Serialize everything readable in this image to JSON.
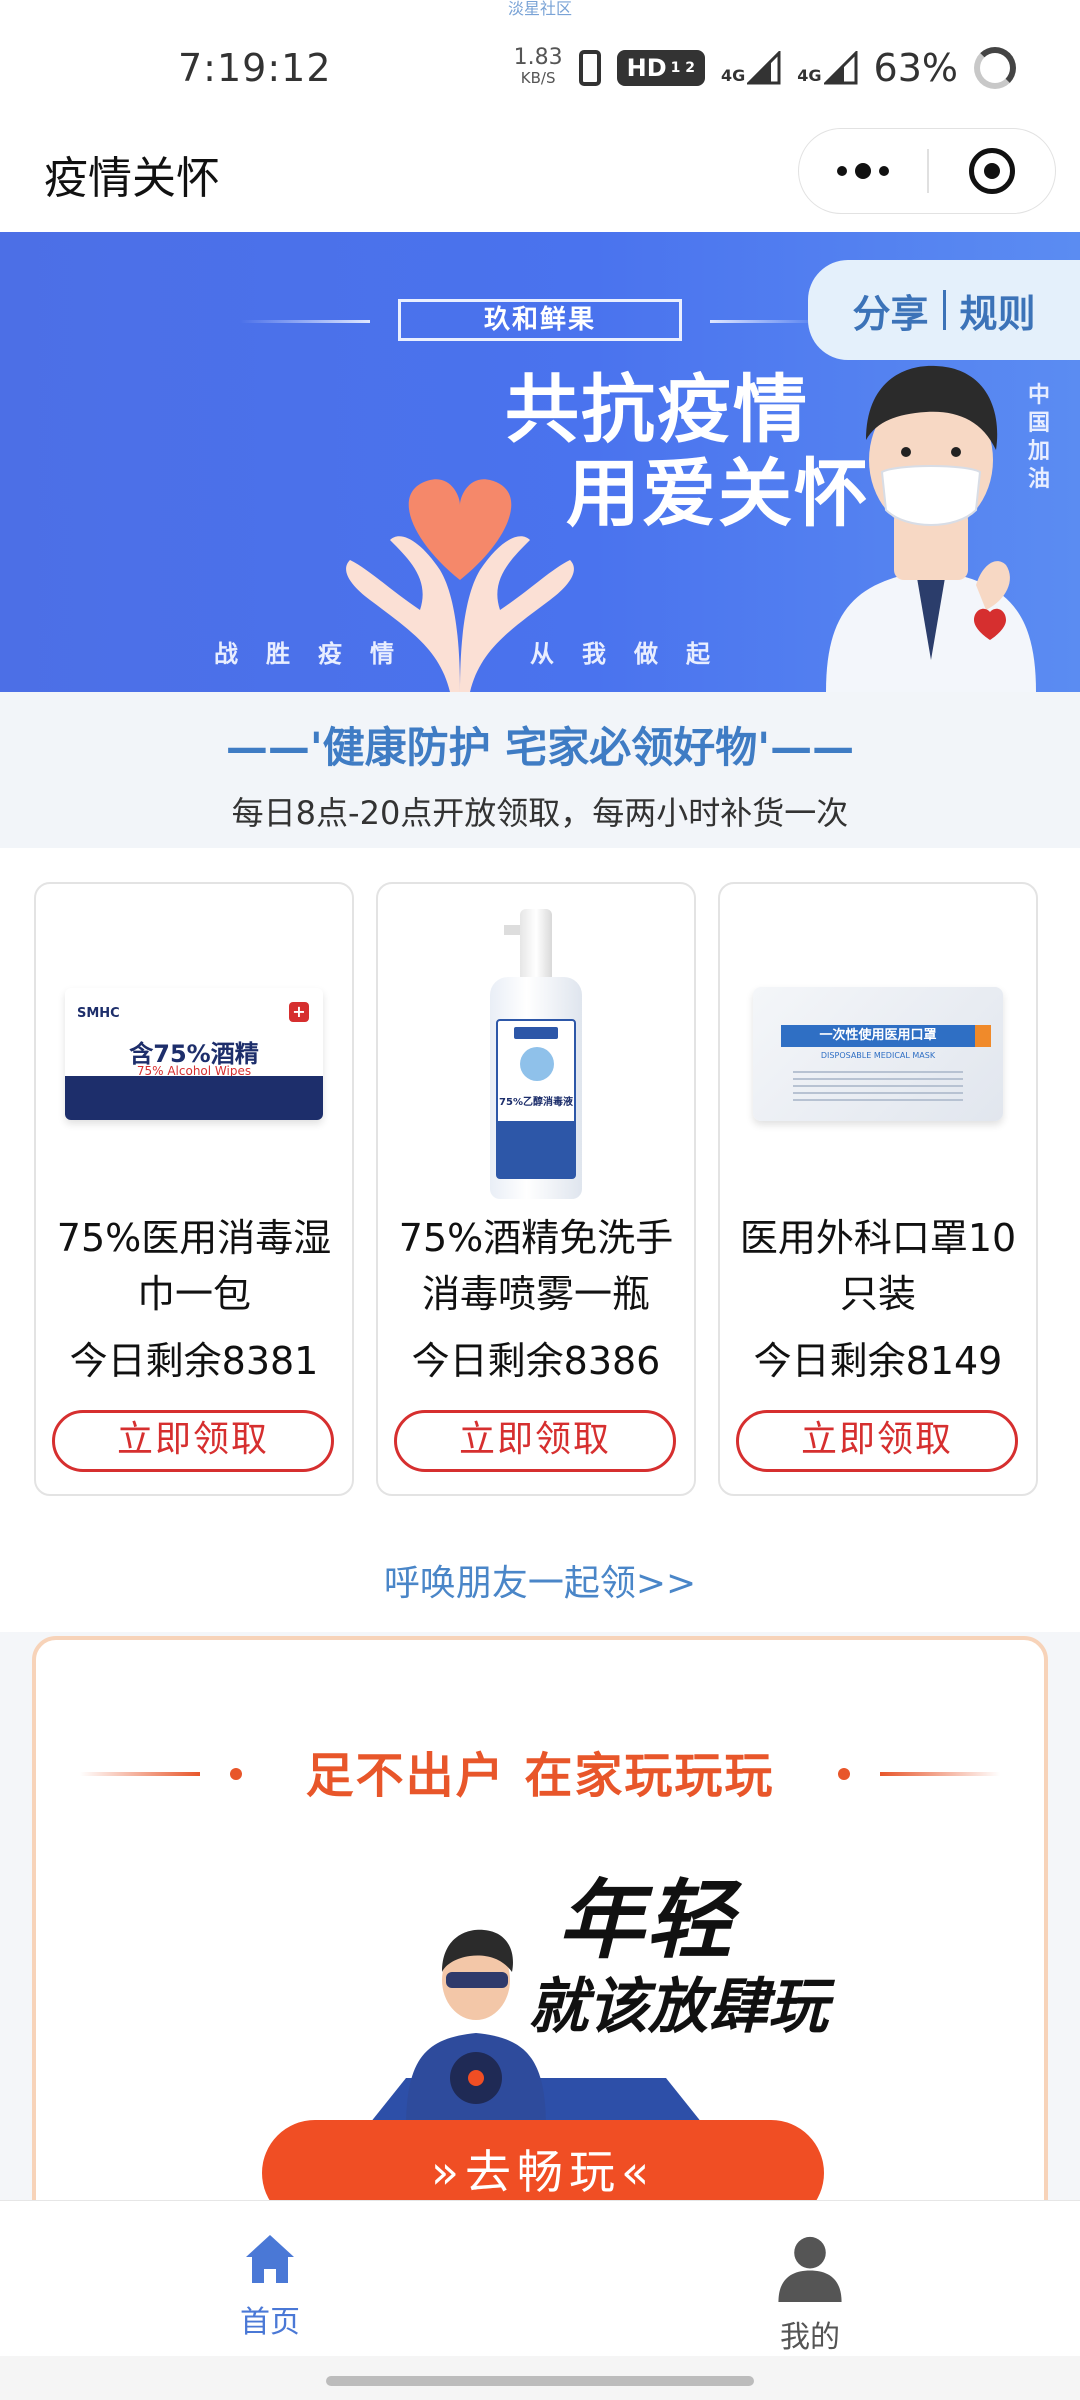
{
  "status": {
    "top_text": "淡星社区",
    "time": "7:19:12",
    "speed_value": "1.83",
    "speed_unit": "KB/S",
    "hd": "HD",
    "hd_sub": "1 2",
    "net1": "4G",
    "net2": "4G",
    "battery": "63%"
  },
  "navbar": {
    "title": "疫情关怀"
  },
  "banner": {
    "brand": "玖和鲜果",
    "headline1": "共抗疫情",
    "headline2": "用爱关怀",
    "slogan_left": "战胜疫情",
    "slogan_right": "从我做起",
    "vertical": "中国加油",
    "share_label": "分享",
    "rules_label": "规则"
  },
  "section": {
    "title": "——'健康防护 宅家必领好物'——",
    "subtitle": "每日8点-20点开放领取，每两小时补货一次"
  },
  "products": [
    {
      "name": "75%医用消毒湿巾一包",
      "stock": "今日剩余8381",
      "button": "立即领取",
      "img_big": "含75%酒精",
      "img_small": "75% Alcohol Wipes",
      "img_logo": "SMHC"
    },
    {
      "name": "75%酒精免洗手消毒喷雾一瓶",
      "stock": "今日剩余8386",
      "button": "立即领取",
      "img_text": "75%乙醇消毒液"
    },
    {
      "name": "医用外科口罩10只装",
      "stock": "今日剩余8149",
      "button": "立即领取",
      "img_text": "一次性使用医用口罩",
      "img_sub": "DISPOSABLE MEDICAL MASK"
    }
  ],
  "invite": {
    "text": "呼唤朋友一起领>>"
  },
  "game": {
    "title": "足不出户   在家玩玩玩",
    "slogan1": "年轻",
    "slogan2": "就该放肆玩",
    "button": "»去畅玩«"
  },
  "tabbar": {
    "home": "首页",
    "mine": "我的",
    "active_color": "#4a78d6"
  }
}
